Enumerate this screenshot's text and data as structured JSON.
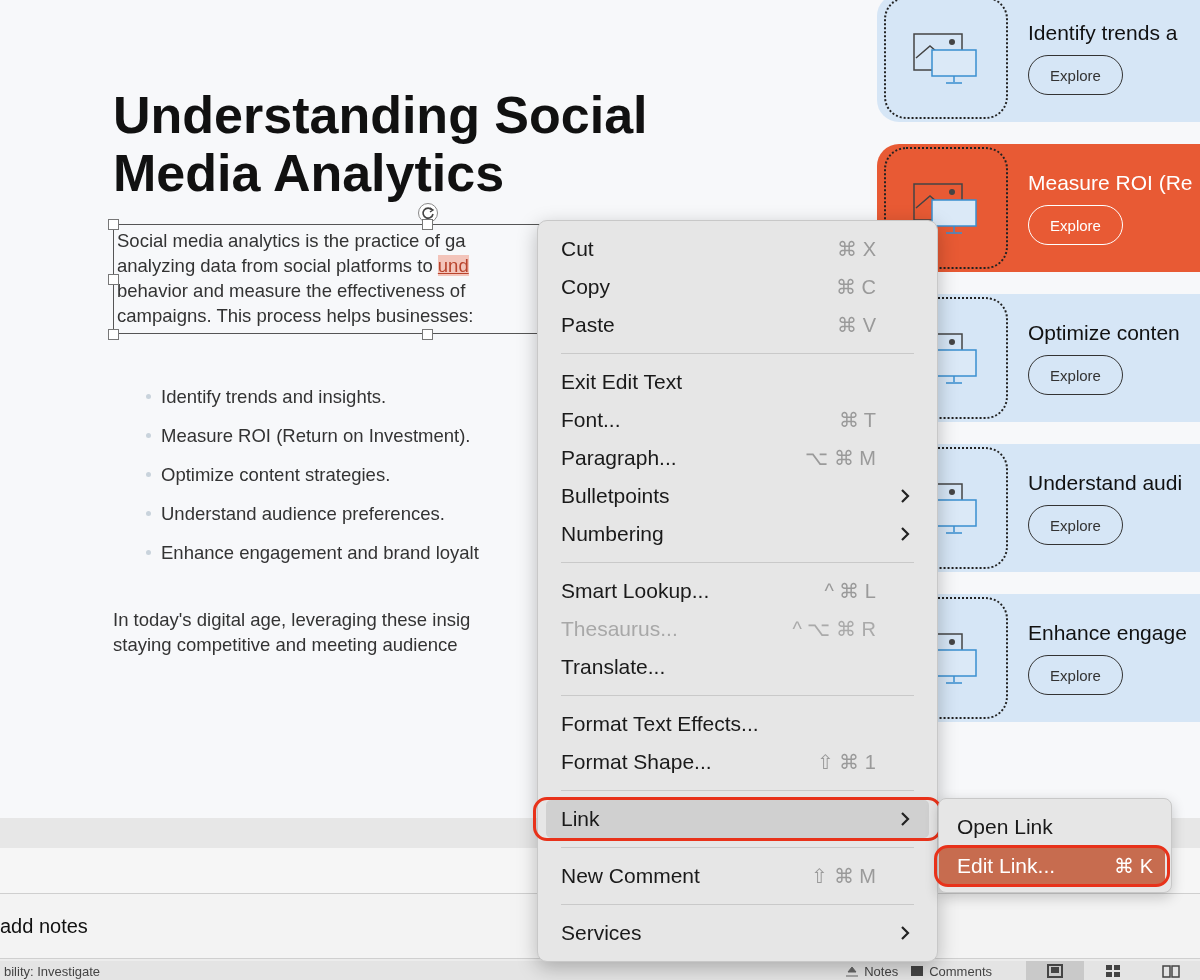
{
  "slide": {
    "title_lines": [
      "Understanding Social",
      "Media Analytics"
    ],
    "intro_lines": [
      [
        {
          "text": "Social media analytics is the practice of ga",
          "highlighted": false
        }
      ],
      [
        {
          "text": "analyzing data from social platforms to ",
          "highlighted": false
        },
        {
          "text": "und",
          "highlighted": true
        }
      ],
      [
        {
          "text": "behavior and measure the effectiveness of",
          "highlighted": false
        }
      ],
      [
        {
          "text": "campaigns. This process helps businesses:",
          "highlighted": false
        }
      ]
    ],
    "bullets": [
      "Identify trends and insights.",
      "Measure ROI (Return on Investment).",
      "Optimize content strategies.",
      "Understand audience preferences.",
      "Enhance engagement and brand loyalt"
    ],
    "closing_lines": [
      "In today's digital age, leveraging these insig",
      "staying competitive and meeting audience"
    ]
  },
  "cards": [
    {
      "title": "Identify trends a",
      "button": "Explore",
      "selected": false
    },
    {
      "title": "Measure ROI (Re",
      "button": "Explore",
      "selected": true
    },
    {
      "title": "Optimize conten",
      "button": "Explore",
      "selected": false
    },
    {
      "title": "Understand audi",
      "button": "Explore",
      "selected": false
    },
    {
      "title": "Enhance engage",
      "button": "Explore",
      "selected": false
    }
  ],
  "context_menu": [
    {
      "kind": "item",
      "label": "Cut",
      "shortcut": "⌘ X",
      "disabled": false,
      "selected": false,
      "annotated": false
    },
    {
      "kind": "item",
      "label": "Copy",
      "shortcut": "⌘ C",
      "disabled": false,
      "selected": false,
      "annotated": false
    },
    {
      "kind": "item",
      "label": "Paste",
      "shortcut": "⌘ V",
      "disabled": false,
      "selected": false,
      "annotated": false
    },
    {
      "kind": "separator"
    },
    {
      "kind": "item",
      "label": "Exit Edit Text",
      "disabled": false,
      "selected": false,
      "annotated": false
    },
    {
      "kind": "item",
      "label": "Font...",
      "shortcut": "⌘ T",
      "disabled": false,
      "selected": false,
      "annotated": false
    },
    {
      "kind": "item",
      "label": "Paragraph...",
      "shortcut": "⌥ ⌘ M",
      "disabled": false,
      "selected": false,
      "annotated": false
    },
    {
      "kind": "submenu",
      "label": "Bulletpoints",
      "disabled": false,
      "selected": false,
      "annotated": false
    },
    {
      "kind": "submenu",
      "label": "Numbering",
      "disabled": false,
      "selected": false,
      "annotated": false
    },
    {
      "kind": "separator"
    },
    {
      "kind": "item",
      "label": "Smart Lookup...",
      "shortcut": "^ ⌘ L",
      "disabled": false,
      "selected": false,
      "annotated": false
    },
    {
      "kind": "item",
      "label": "Thesaurus...",
      "shortcut": "^ ⌥ ⌘ R",
      "disabled": true,
      "selected": false,
      "annotated": false
    },
    {
      "kind": "item",
      "label": "Translate...",
      "disabled": false,
      "selected": false,
      "annotated": false
    },
    {
      "kind": "separator"
    },
    {
      "kind": "item",
      "label": "Format Text Effects...",
      "disabled": false,
      "selected": false,
      "annotated": false
    },
    {
      "kind": "item",
      "label": "Format Shape...",
      "shortcut": "⇧ ⌘ 1",
      "disabled": false,
      "selected": false,
      "annotated": false
    },
    {
      "kind": "separator"
    },
    {
      "kind": "submenu",
      "label": "Link",
      "disabled": false,
      "selected": true,
      "annotated": true
    },
    {
      "kind": "separator"
    },
    {
      "kind": "item",
      "label": "New Comment",
      "shortcut": "⇧ ⌘ M",
      "disabled": false,
      "selected": false,
      "annotated": false
    },
    {
      "kind": "separator"
    },
    {
      "kind": "submenu",
      "label": "Services",
      "disabled": false,
      "selected": false,
      "annotated": false
    }
  ],
  "submenu": [
    {
      "label": "Open Link",
      "selected": false,
      "annotated": false
    },
    {
      "label": "Edit Link...",
      "shortcut": "⌘ K",
      "selected": true,
      "annotated": true
    }
  ],
  "notes": {
    "placeholder": "add notes"
  },
  "status_bar": {
    "accessibility": "bility: Investigate",
    "notes_button": "Notes",
    "comments_button": "Comments",
    "views": [
      {
        "selected": true
      },
      {
        "selected": false
      },
      {
        "selected": false
      }
    ]
  }
}
